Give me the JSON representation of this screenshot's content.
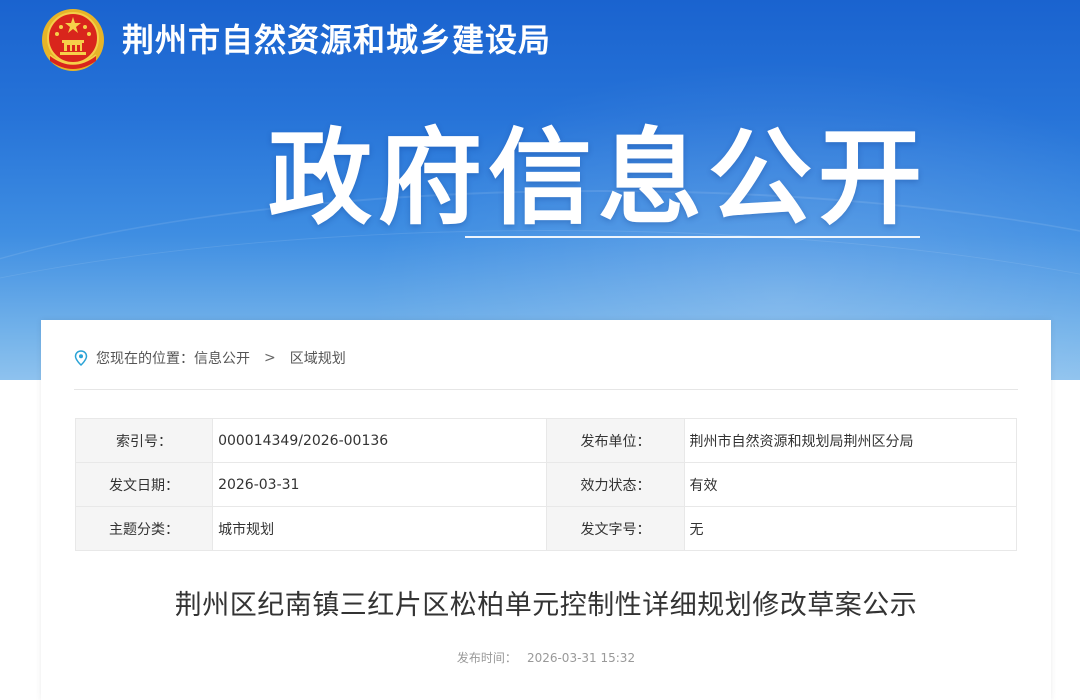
{
  "header": {
    "site_name": "荆州市自然资源和城乡建设局",
    "hero_title": "政府信息公开"
  },
  "breadcrumb": {
    "prefix": "您现在的位置：",
    "items": [
      "信息公开",
      "区域规划"
    ],
    "separator": ">"
  },
  "meta": {
    "rows": [
      {
        "l1": "索引号：",
        "v1": "000014349/2026-00136",
        "l2": "发布单位：",
        "v2": "荆州市自然资源和规划局荆州区分局"
      },
      {
        "l1": "发文日期：",
        "v1": "2026-03-31",
        "l2": "效力状态：",
        "v2": "有效"
      },
      {
        "l1": "主题分类：",
        "v1": "城市规划",
        "l2": "发文字号：",
        "v2": "无"
      }
    ]
  },
  "document": {
    "title": "荆州区纪南镇三红片区松柏单元控制性详细规划修改草案公示",
    "publish_label": "发布时间：",
    "publish_time": "2026-03-31 15:32"
  },
  "colors": {
    "banner_top": "#1a63cf",
    "banner_bottom": "#8ec2ee",
    "pin_icon": "#2aa3d6"
  }
}
